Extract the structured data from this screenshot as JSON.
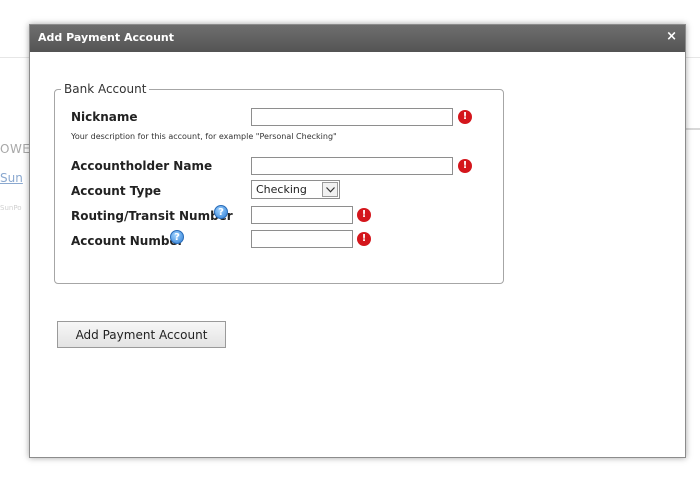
{
  "background": {
    "text1": "OWER",
    "text2": "Sun",
    "text3": "SunPo"
  },
  "dialog": {
    "title": "Add Payment Account",
    "close_glyph": "×"
  },
  "form": {
    "legend": "Bank Account",
    "nickname_label": "Nickname",
    "nickname_value": "",
    "nickname_hint": "Your description for this account, for example \"Personal Checking\"",
    "holder_label": "Accountholder Name",
    "holder_value": "",
    "type_label": "Account Type",
    "type_selected": "Checking",
    "routing_label": "Routing/Transit Number",
    "routing_value": "",
    "account_label": "Account Number",
    "account_value": "",
    "required_glyph": "!",
    "help_glyph": "?",
    "submit_label": "Add Payment Account"
  },
  "icons": {
    "required": "exclamation-circle-icon",
    "help": "question-circle-icon",
    "close": "close-icon",
    "dropdown": "chevron-down-icon"
  },
  "colors": {
    "titlebar": "#5e5e5e",
    "required": "#d4161c",
    "help": "#2f7fd6",
    "link": "#8aa8cf"
  }
}
